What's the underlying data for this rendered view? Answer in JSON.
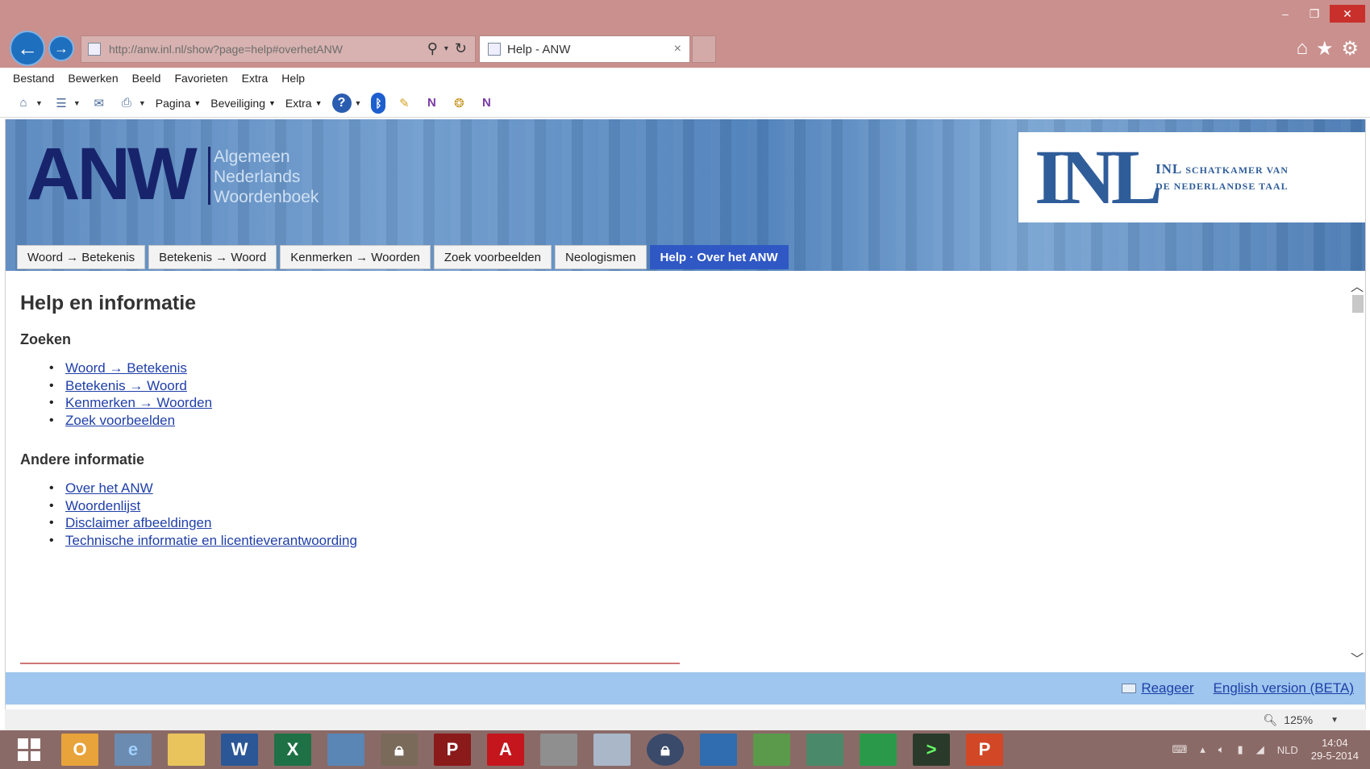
{
  "browser": {
    "url": "http://anw.inl.nl/show?page=help#overhetANW",
    "tab_title": "Help - ANW",
    "tab_close": "×",
    "window_controls": [
      "–",
      "❐",
      "✕"
    ],
    "menu": [
      "Bestand",
      "Bewerken",
      "Beeld",
      "Favorieten",
      "Extra",
      "Help"
    ],
    "cmd_labels": {
      "pagina": "Pagina",
      "beveiliging": "Beveiliging",
      "extra": "Extra"
    }
  },
  "banner": {
    "logo": "ANW",
    "subtitle_lines": [
      "Algemeen",
      "Nederlands",
      "Woordenboek"
    ],
    "inl_mark": "INL",
    "inl_line1_lead": "INL",
    "inl_line1": " SCHATKAMER VAN",
    "inl_line2": "DE NEDERLANDSE TAAL"
  },
  "navtabs": [
    {
      "label": "Woord → Betekenis",
      "active": false
    },
    {
      "label": "Betekenis → Woord",
      "active": false
    },
    {
      "label": "Kenmerken → Woorden",
      "active": false
    },
    {
      "label": "Zoek voorbeelden",
      "active": false
    },
    {
      "label": "Neologismen",
      "active": false
    },
    {
      "label": "Help · Over het ANW",
      "active": true
    }
  ],
  "content": {
    "title": "Help en informatie",
    "section1": {
      "heading": "Zoeken",
      "links": [
        "Woord → Betekenis",
        "Betekenis → Woord",
        "Kenmerken → Woorden",
        "Zoek voorbeelden"
      ]
    },
    "section2": {
      "heading": "Andere informatie",
      "links": [
        "Over het ANW",
        "Woordenlijst",
        "Disclaimer afbeeldingen",
        "Technische informatie en licentieverantwoording"
      ]
    }
  },
  "footer": {
    "reageer": "Reageer",
    "english": "English version (BETA)"
  },
  "statusbar": {
    "zoom": "125%"
  },
  "taskbar": {
    "lang": "NLD",
    "time": "14:04",
    "date": "29-5-2014"
  },
  "colors": {
    "titlebar": "#c9908d",
    "active_tab": "#2f58c4",
    "link": "#1f3fa8",
    "footer": "#9ec6ee"
  }
}
